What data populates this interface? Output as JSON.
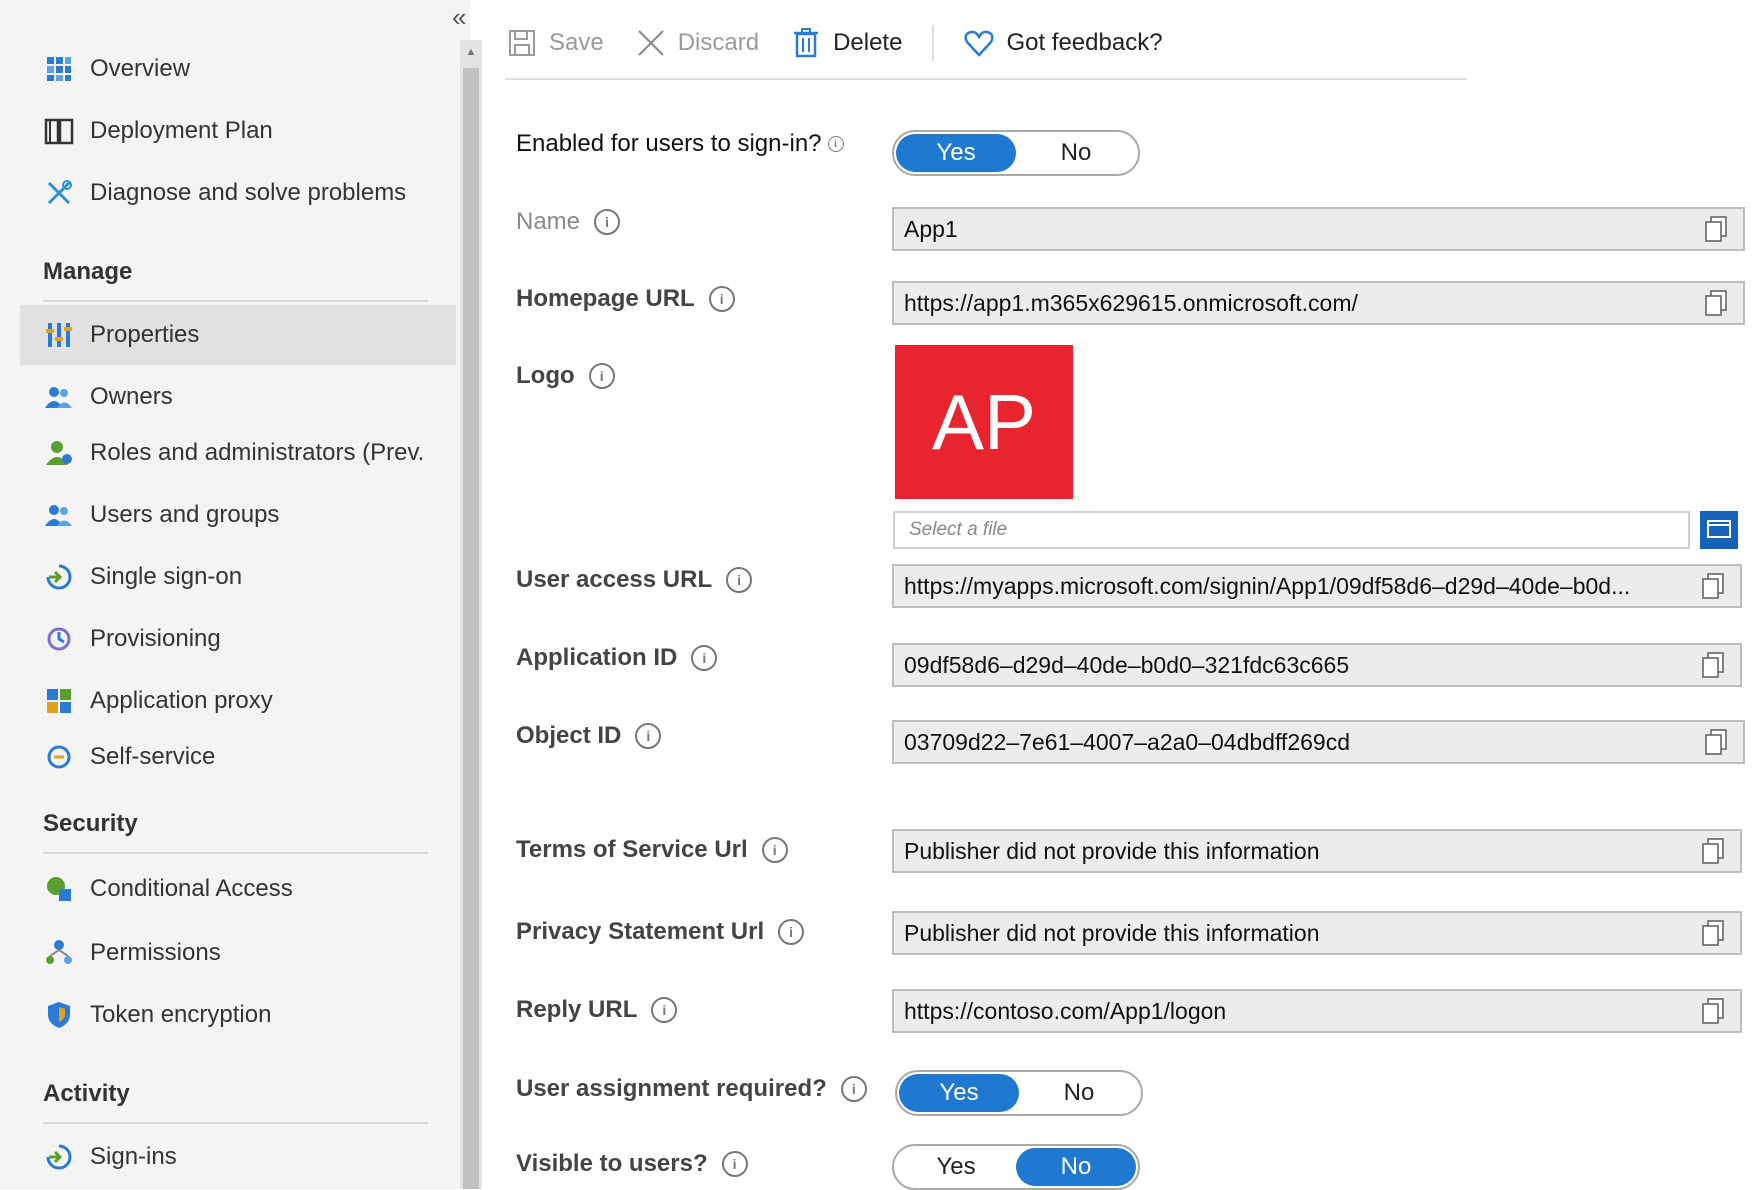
{
  "sidebar": {
    "collapse_label": "«",
    "items": [
      {
        "label": "Overview",
        "icon": "overview-grid-icon"
      },
      {
        "label": "Deployment Plan",
        "icon": "book-icon"
      },
      {
        "label": "Diagnose and solve problems",
        "icon": "wrench-icon"
      },
      {
        "label": "Properties",
        "icon": "properties-bars-icon"
      },
      {
        "label": "Owners",
        "icon": "owners-people-icon"
      },
      {
        "label": "Roles and administrators (Prev.",
        "icon": "roles-person-icon"
      },
      {
        "label": "Users and groups",
        "icon": "users-groups-icon"
      },
      {
        "label": "Single sign-on",
        "icon": "sign-in-arrow-icon"
      },
      {
        "label": "Provisioning",
        "icon": "provisioning-icon"
      },
      {
        "label": "Application proxy",
        "icon": "app-proxy-icon"
      },
      {
        "label": "Self-service",
        "icon": "self-service-icon"
      },
      {
        "label": "Conditional Access",
        "icon": "conditional-access-icon"
      },
      {
        "label": "Permissions",
        "icon": "permissions-icon"
      },
      {
        "label": "Token encryption",
        "icon": "shield-icon"
      },
      {
        "label": "Sign-ins",
        "icon": "sign-ins-arrow-icon"
      }
    ],
    "sections": {
      "manage": "Manage",
      "security": "Security",
      "activity": "Activity"
    },
    "active_item": "Properties"
  },
  "toolbar": {
    "save_label": "Save",
    "discard_label": "Discard",
    "delete_label": "Delete",
    "feedback_label": "Got feedback?"
  },
  "form": {
    "enabled_label": "Enabled for users to sign-in?",
    "enabled_yes": "Yes",
    "enabled_no": "No",
    "enabled_value": "Yes",
    "name_label": "Name",
    "name_value": "App1",
    "homepage_label": "Homepage URL",
    "homepage_value": "https://app1.m365x629615.onmicrosoft.com/",
    "logo_label": "Logo",
    "logo_text": "AP",
    "logo_color": "#e8252e",
    "select_file_placeholder": "Select a file",
    "user_access_label": "User access URL",
    "user_access_value": "https://myapps.microsoft.com/signin/App1/09df58d6–d29d–40de–b0d...",
    "app_id_label": "Application ID",
    "app_id_value": "09df58d6–d29d–40de–b0d0–321fdc63c665",
    "object_id_label": "Object ID",
    "object_id_value": "03709d22–7e61–4007–a2a0–04dbdff269cd",
    "tos_label": "Terms of Service Url",
    "tos_value": "Publisher did not provide this information",
    "privacy_label": "Privacy Statement Url",
    "privacy_value": "Publisher did not provide this information",
    "reply_label": "Reply URL",
    "reply_value": "https://contoso.com/App1/logon",
    "assignment_label": "User assignment required?",
    "assignment_yes": "Yes",
    "assignment_no": "No",
    "assignment_value": "Yes",
    "visible_label": "Visible to users?",
    "visible_yes": "Yes",
    "visible_no": "No",
    "visible_value": "No"
  },
  "colors": {
    "accent": "#1f79d0",
    "logo_bg": "#e8252e",
    "active_item_bg": "#e1e1e1"
  }
}
